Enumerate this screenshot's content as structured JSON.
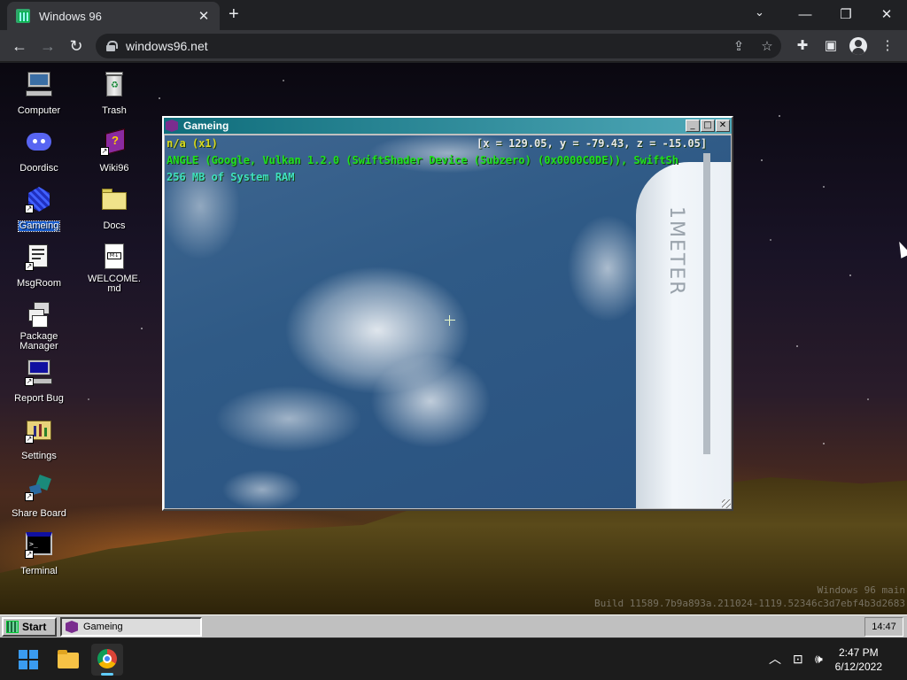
{
  "browser": {
    "tab_title": "Windows 96",
    "tab_close": "✕",
    "new_tab": "+",
    "url": "windows96.net",
    "controls": {
      "dropdown": "⌄",
      "minimize": "—",
      "restore": "❐",
      "close": "✕"
    }
  },
  "desktop": {
    "icons": [
      {
        "label": "Computer",
        "icon": "computer-icon"
      },
      {
        "label": "Trash",
        "icon": "trash-icon"
      },
      {
        "label": "Doordisc",
        "icon": "discord-icon"
      },
      {
        "label": "Wiki96",
        "icon": "book-icon"
      },
      {
        "label": "Gameing",
        "icon": "cube-icon",
        "selected": true
      },
      {
        "label": "Docs",
        "icon": "folder-icon"
      },
      {
        "label": "MsgRoom",
        "icon": "chat-icon"
      },
      {
        "label": "WELCOME.md",
        "icon": "markdown-file-icon"
      },
      {
        "label": "Package Manager",
        "icon": "package-icon"
      },
      {
        "label": "Report Bug",
        "icon": "bug-report-icon"
      },
      {
        "label": "Settings",
        "icon": "settings-icon"
      },
      {
        "label": "Share Board",
        "icon": "share-board-icon"
      },
      {
        "label": "Terminal",
        "icon": "terminal-icon"
      }
    ]
  },
  "window": {
    "title": "Gameing",
    "hud": {
      "version": "n/a (x1)",
      "coords": "[x = 129.05, y = -79.43, z = -15.05]",
      "renderer": "ANGLE (Google, Vulkan 1.2.0 (SwiftShader Device (Subzero) (0x0000C0DE)), SwiftSh",
      "memory": "256 MB of System RAM"
    },
    "scene_sign": "1METER"
  },
  "watermark": {
    "line1": "Windows 96 main",
    "line2": "Build 11589.7b9a893a.211024-1119.52346c3d7ebf4b3d2683"
  },
  "w96_taskbar": {
    "start_label": "Start",
    "task_label": "Gameing",
    "clock": "14:47"
  },
  "win_taskbar": {
    "time": "2:47 PM",
    "date": "6/12/2022"
  },
  "colors": {
    "hud_yellow": "#d8d820",
    "hud_green": "#20e020",
    "hud_cyan": "#40e0c0",
    "titlebar": "#0f6d7b",
    "selection": "#1a5fd0"
  }
}
